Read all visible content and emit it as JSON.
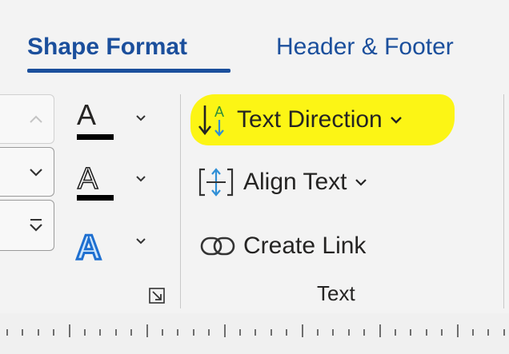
{
  "tabs": [
    {
      "label": "Shape Format",
      "active": true
    },
    {
      "label": "Header & Footer",
      "active": false
    }
  ],
  "gallery_scroll": {
    "up": "scroll-up",
    "down": "scroll-down",
    "more": "gallery-more"
  },
  "text_styles": [
    {
      "name": "text-fill",
      "glyph": "A"
    },
    {
      "name": "text-outline",
      "glyph": "A"
    },
    {
      "name": "text-effects",
      "glyph": "A"
    }
  ],
  "text_group": {
    "text_direction": "Text Direction",
    "align_text": "Align Text",
    "create_link": "Create Link",
    "label": "Text"
  },
  "colors": {
    "accent": "#1b4f9c",
    "highlight": "#fcf515",
    "icon_green": "#2f8f3a",
    "icon_blue": "#2f8fd6"
  }
}
